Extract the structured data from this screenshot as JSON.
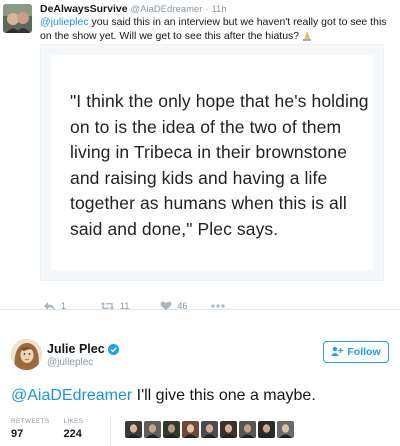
{
  "reply": {
    "display_name": "DeAlwaysSurvive",
    "handle": "@AiaDEdreamer",
    "separator": "·",
    "time": "11h",
    "mention": "@julieplec",
    "text": " you said this in an interview but we haven't really got to see this on the show yet. Will we get to see this after the hiatus?",
    "emoji": "folded-hands-icon",
    "quote": "\"I think the only hope that he's holding on to is the idea of the two of them living in Tribeca in their brownstone and raising kids and having a life together as humans when this is all said and done,\" Plec says.",
    "actions": {
      "reply_count": "1",
      "retweet_count": "11",
      "like_count": "46"
    }
  },
  "original": {
    "display_name": "Julie Plec",
    "handle": "@julieplec",
    "verified": true,
    "follow_label": "Follow",
    "mention": "@AiaDEdreamer",
    "text": " I'll give this one a maybe.",
    "retweets_label": "RETWEETS",
    "retweets_value": "97",
    "likes_label": "LIKES",
    "likes_value": "224",
    "liker_avatar_count": 9
  },
  "colors": {
    "link": "#1b95e0",
    "follow": "#1da1f2",
    "muted": "#8899a6",
    "icon": "#aab8c2"
  }
}
